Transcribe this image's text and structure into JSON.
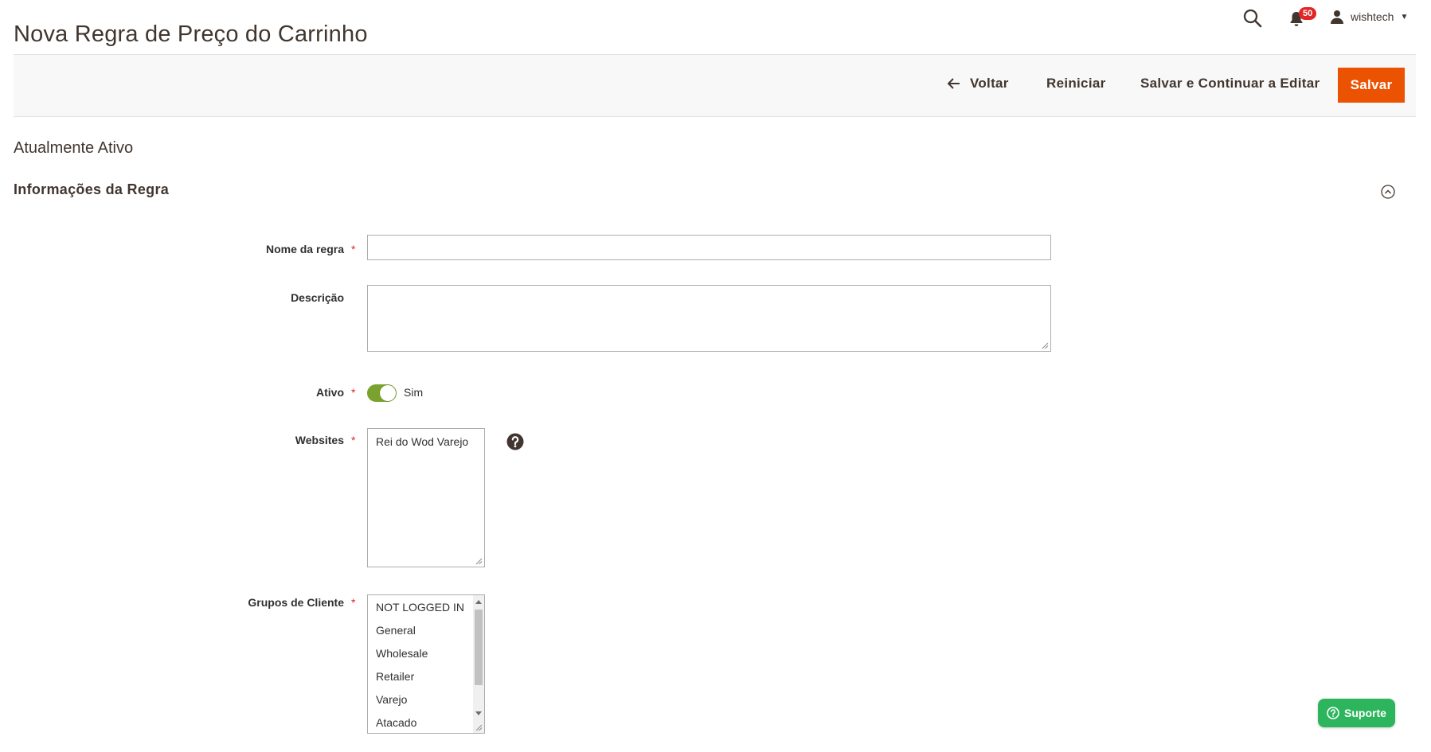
{
  "page": {
    "title": "Nova Regra de Preço do Carrinho"
  },
  "header": {
    "notifications_count": "50",
    "username": "wishtech",
    "icons": [
      "search-icon",
      "bell-icon",
      "user-icon",
      "caret-down-icon"
    ]
  },
  "toolbar": {
    "back_label": "Voltar",
    "reset_label": "Reiniciar",
    "save_continue_label": "Salvar e Continuar a Editar",
    "save_label": "Salvar"
  },
  "status": {
    "text": "Atualmente Ativo"
  },
  "section": {
    "title": "Informações da Regra"
  },
  "form": {
    "rule_name": {
      "label": "Nome da regra",
      "value": "",
      "required": true
    },
    "description": {
      "label": "Descrição",
      "value": ""
    },
    "active": {
      "label": "Ativo",
      "state_text": "Sim",
      "enabled": true,
      "required": true
    },
    "websites": {
      "label": "Websites",
      "options": [
        "Rei do Wod Varejo"
      ],
      "required": true
    },
    "customer_groups": {
      "label": "Grupos de Cliente",
      "options": [
        "NOT LOGGED IN",
        "General",
        "Wholesale",
        "Retailer",
        "Varejo",
        "Atacado"
      ],
      "required": true
    }
  },
  "support": {
    "label": "Suporte"
  },
  "colors": {
    "accent": "#eb5202",
    "toggle_on": "#79a22e",
    "required": "#e22626",
    "support": "#2db55d"
  }
}
